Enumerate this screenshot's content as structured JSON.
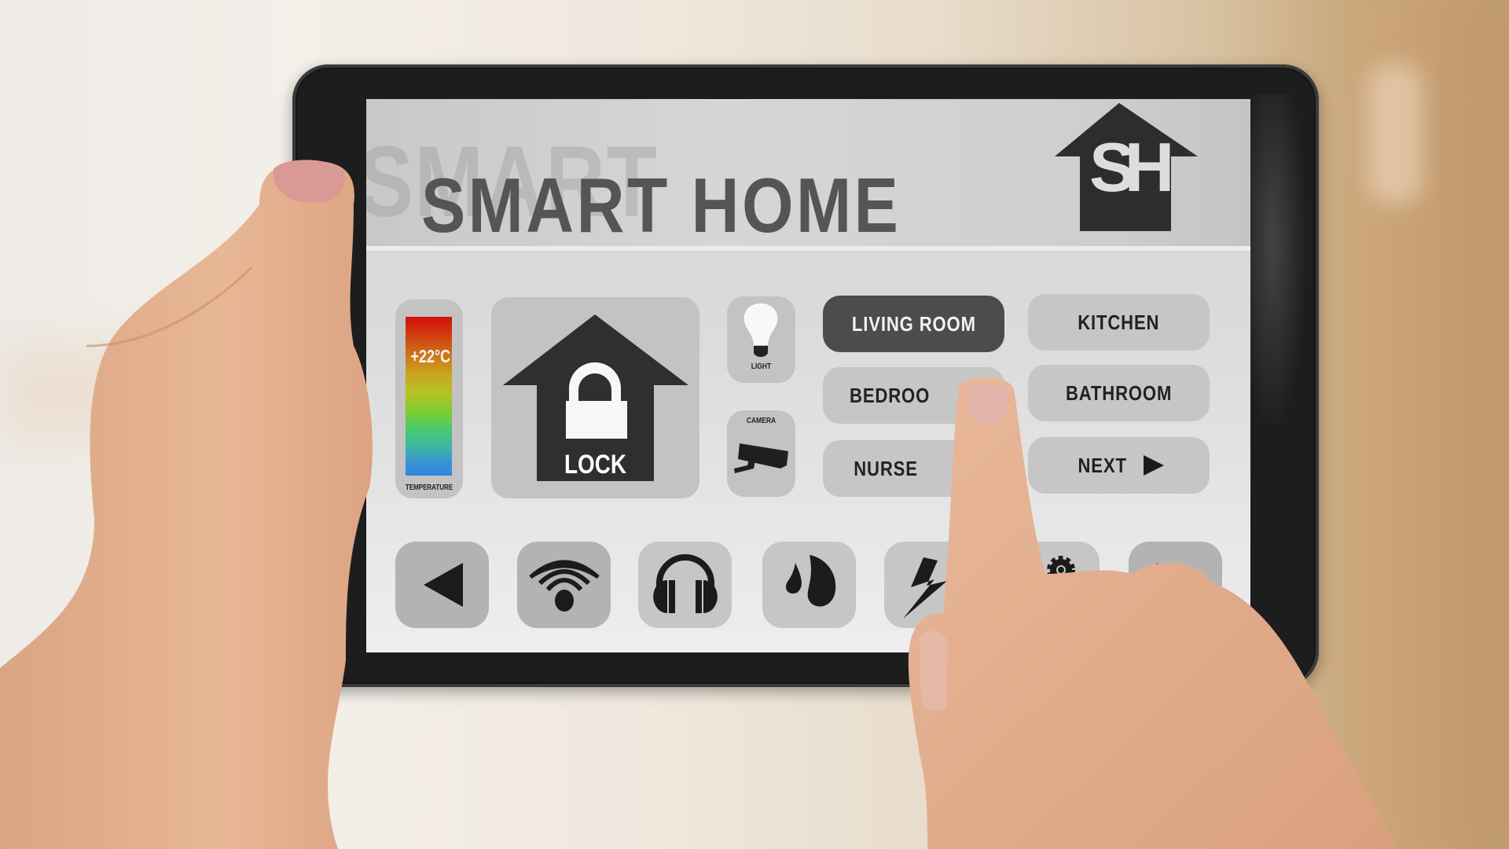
{
  "app": {
    "title": "SMART HOME",
    "background_title": "SMART",
    "logo_text": "SH"
  },
  "widgets": {
    "temperature": {
      "value": "+22°C",
      "label": "TEMPERATURE"
    },
    "lock": {
      "label": "LOCK"
    },
    "light": {
      "label": "LIGHT"
    },
    "camera": {
      "label": "CAMERA"
    }
  },
  "rooms": [
    {
      "label": "LIVING ROOM",
      "active": true
    },
    {
      "label": "KITCHEN",
      "active": false
    },
    {
      "label": "BEDROO",
      "active": false
    },
    {
      "label": "BATHROOM",
      "active": false
    },
    {
      "label": "NURSE",
      "active": false
    },
    {
      "label": "NEXT",
      "active": false,
      "icon": "play-right-icon"
    }
  ],
  "toolbar": [
    {
      "icon": "previous-arrow-icon"
    },
    {
      "icon": "wifi-signal-icon"
    },
    {
      "icon": "headphones-icon"
    },
    {
      "icon": "water-drops-icon"
    },
    {
      "icon": "lightning-bolt-icon"
    },
    {
      "icon": "gears-icon"
    },
    {
      "icon": "next-arrow-icon"
    }
  ],
  "colors": {
    "active_button": "#4c4c4c",
    "button": "#c6c6c6",
    "icon": "#1b1b1b",
    "title": "#555555"
  }
}
